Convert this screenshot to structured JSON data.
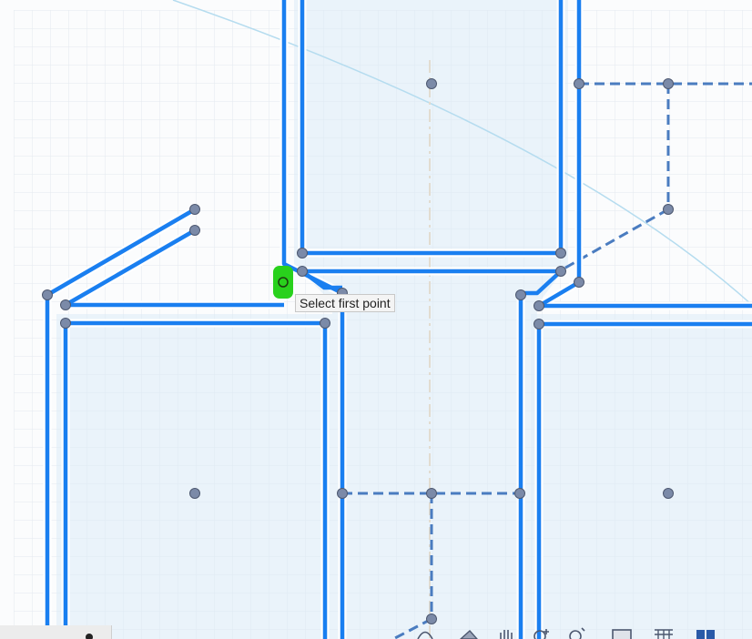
{
  "tooltip": {
    "text": "Select first point"
  },
  "cursor": {
    "icon": "point-snap-cursor-icon"
  },
  "colors": {
    "sketch_line": "#1a7ff0",
    "construction_line": "#4a7cc0",
    "sketch_point": "#7b8aa8",
    "profile_fill": "#dcebf8",
    "grid_minor": "#e3e9ee",
    "grid_major": "#cdd6de",
    "snap_highlight": "#29d11c",
    "tooltip_bg": "#f4f4f4"
  },
  "navigation_bar": {
    "icons": [
      "orbit-icon",
      "look-at-icon",
      "pan-icon",
      "zoom-icon",
      "fit-icon",
      "display-settings-icon",
      "grid-settings-icon",
      "viewports-icon"
    ]
  }
}
